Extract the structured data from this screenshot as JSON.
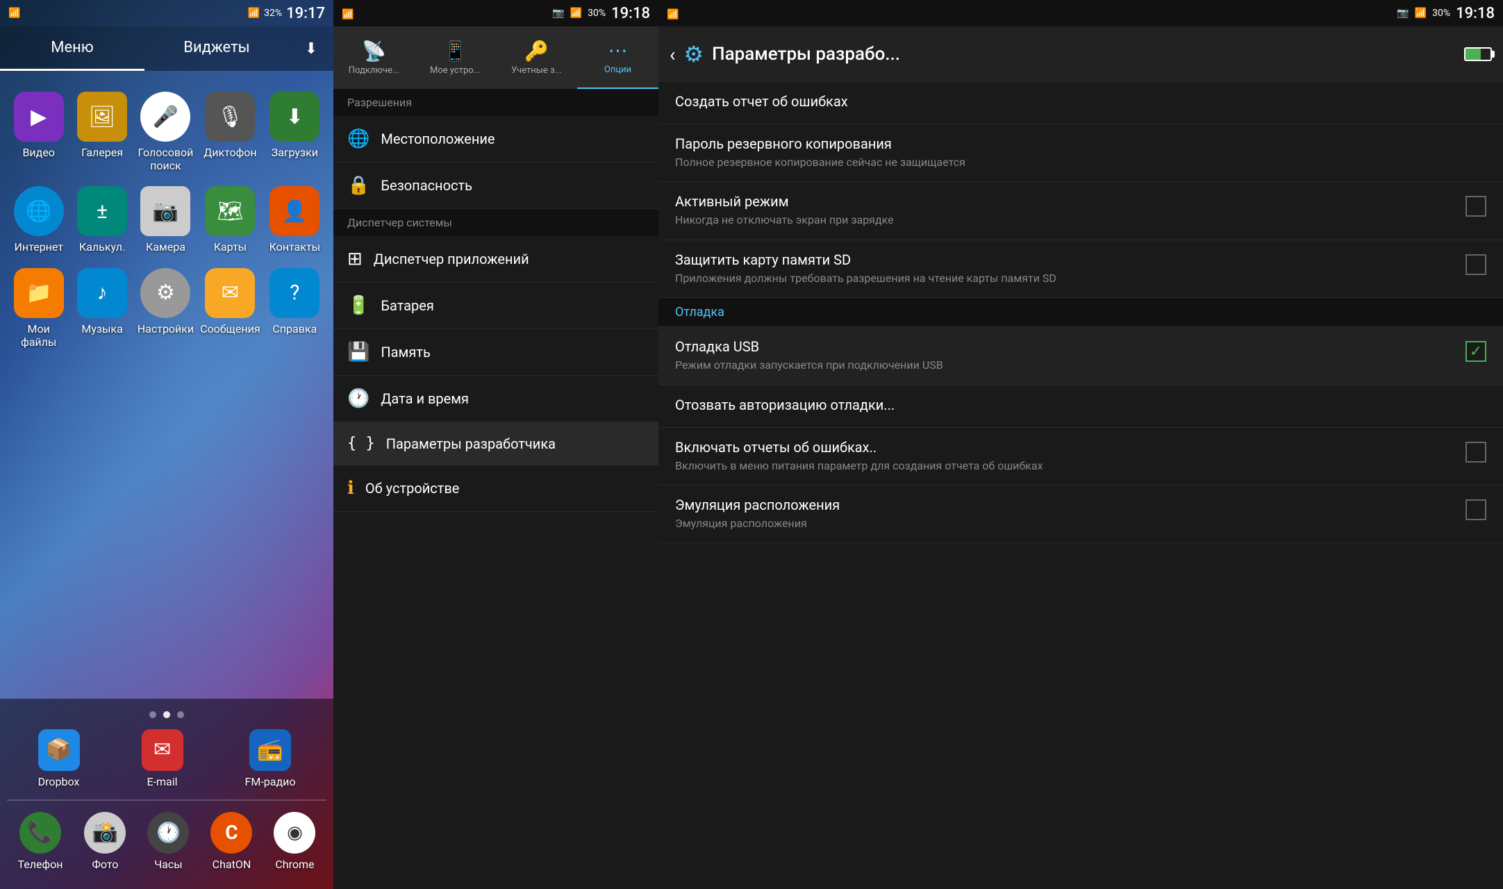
{
  "panel1": {
    "status": {
      "time": "19:17",
      "battery": "32%"
    },
    "tabs": [
      {
        "label": "Меню",
        "active": true
      },
      {
        "label": "Виджеты",
        "active": false
      }
    ],
    "apps": [
      {
        "label": "Видео",
        "icon": "▶",
        "color": "#7b2fbe"
      },
      {
        "label": "Галерея",
        "icon": "🖼",
        "color": "#c8900a"
      },
      {
        "label": "Голосовой поиск",
        "icon": "🎤",
        "color": "#ddd"
      },
      {
        "label": "Диктофон",
        "icon": "🎙",
        "color": "#555"
      },
      {
        "label": "Загрузки",
        "icon": "⬇",
        "color": "#2e7d32"
      },
      {
        "label": "Интернет",
        "icon": "🌐",
        "color": "#0288d1"
      },
      {
        "label": "Калькул.",
        "icon": "🔢",
        "color": "#00897b"
      },
      {
        "label": "Камера",
        "icon": "📷",
        "color": "#ddd"
      },
      {
        "label": "Карты",
        "icon": "🗺",
        "color": "#388e3c"
      },
      {
        "label": "Контакты",
        "icon": "👤",
        "color": "#e65100"
      },
      {
        "label": "Мои файлы",
        "icon": "📁",
        "color": "#f57c00"
      },
      {
        "label": "Музыка",
        "icon": "▶",
        "color": "#0288d1"
      },
      {
        "label": "Настройки",
        "icon": "⚙",
        "color": "#ddd"
      },
      {
        "label": "Сообщения",
        "icon": "✉",
        "color": "#f9a825"
      },
      {
        "label": "Справка",
        "icon": "?",
        "color": "#0288d1"
      }
    ],
    "dock": [
      {
        "label": "Телефон",
        "icon": "📞",
        "color": "#2e7d32"
      },
      {
        "label": "Фото",
        "icon": "📸",
        "color": "#ddd"
      },
      {
        "label": "Часы",
        "icon": "🕐",
        "color": "#ddd"
      },
      {
        "label": "ChatON",
        "icon": "C",
        "color": "#e65100"
      },
      {
        "label": "Chrome",
        "icon": "◉",
        "color": "#fff"
      }
    ],
    "bottom_row": [
      {
        "label": "Dropbox",
        "icon": "📦",
        "color": "#1e88e5"
      },
      {
        "label": "E-mail",
        "icon": "✉",
        "color": "#d32f2f"
      },
      {
        "label": "FM-радио",
        "icon": "📻",
        "color": "#1565c0"
      }
    ]
  },
  "panel2": {
    "status": {
      "time": "19:18",
      "battery": "30%"
    },
    "tabs": [
      {
        "label": "Подключе...",
        "icon": "📡",
        "active": false
      },
      {
        "label": "Мое устро...",
        "icon": "📱",
        "active": false
      },
      {
        "label": "Учетные з...",
        "icon": "🔑",
        "active": false
      },
      {
        "label": "Опции",
        "icon": "⋯",
        "active": true
      }
    ],
    "section_header": "Разрешения",
    "items": [
      {
        "label": "Местоположение",
        "icon": "🌐"
      },
      {
        "label": "Безопасность",
        "icon": "🔒"
      },
      {
        "label": "Диспетчер системы",
        "icon": "",
        "is_header": true
      },
      {
        "label": "Диспетчер приложений",
        "icon": "⊞"
      },
      {
        "label": "Батарея",
        "icon": "🔋"
      },
      {
        "label": "Память",
        "icon": "💾"
      },
      {
        "label": "Дата и время",
        "icon": "🕐"
      },
      {
        "label": "Параметры разработчика",
        "icon": "{ }"
      },
      {
        "label": "Об устройстве",
        "icon": "ℹ"
      }
    ]
  },
  "panel3": {
    "status": {
      "time": "19:18",
      "battery": "30%"
    },
    "header": {
      "title": "Параметры разрабо...",
      "back_icon": "‹",
      "settings_icon": "⚙"
    },
    "items": [
      {
        "title": "Создать отчет об ошибках",
        "sub": "",
        "has_checkbox": false,
        "checked": false,
        "is_section": false
      },
      {
        "title": "Пароль резервного копирования",
        "sub": "Полное резервное копирование сейчас не защищается",
        "has_checkbox": false,
        "checked": false,
        "is_section": false
      },
      {
        "title": "Активный режим",
        "sub": "Никогда не отключать экран при зарядке",
        "has_checkbox": true,
        "checked": false,
        "is_section": false
      },
      {
        "title": "Защитить карту памяти SD",
        "sub": "Приложения должны требовать разрешения на чтение карты памяти SD",
        "has_checkbox": true,
        "checked": false,
        "is_section": false
      },
      {
        "title": "Отладка",
        "sub": "",
        "has_checkbox": false,
        "checked": false,
        "is_section": true
      },
      {
        "title": "Отладка USB",
        "sub": "Режим отладки запускается при подключении USB",
        "has_checkbox": true,
        "checked": true,
        "is_section": false
      },
      {
        "title": "Отозвать авторизацию отладки...",
        "sub": "",
        "has_checkbox": false,
        "checked": false,
        "is_section": false
      },
      {
        "title": "Включать отчеты об ошибках..",
        "sub": "Включить в меню питания параметр для создания отчета об ошибках",
        "has_checkbox": true,
        "checked": false,
        "is_section": false
      },
      {
        "title": "Эмуляция расположения",
        "sub": "Эмуляция расположения",
        "has_checkbox": true,
        "checked": false,
        "is_section": false
      }
    ]
  }
}
